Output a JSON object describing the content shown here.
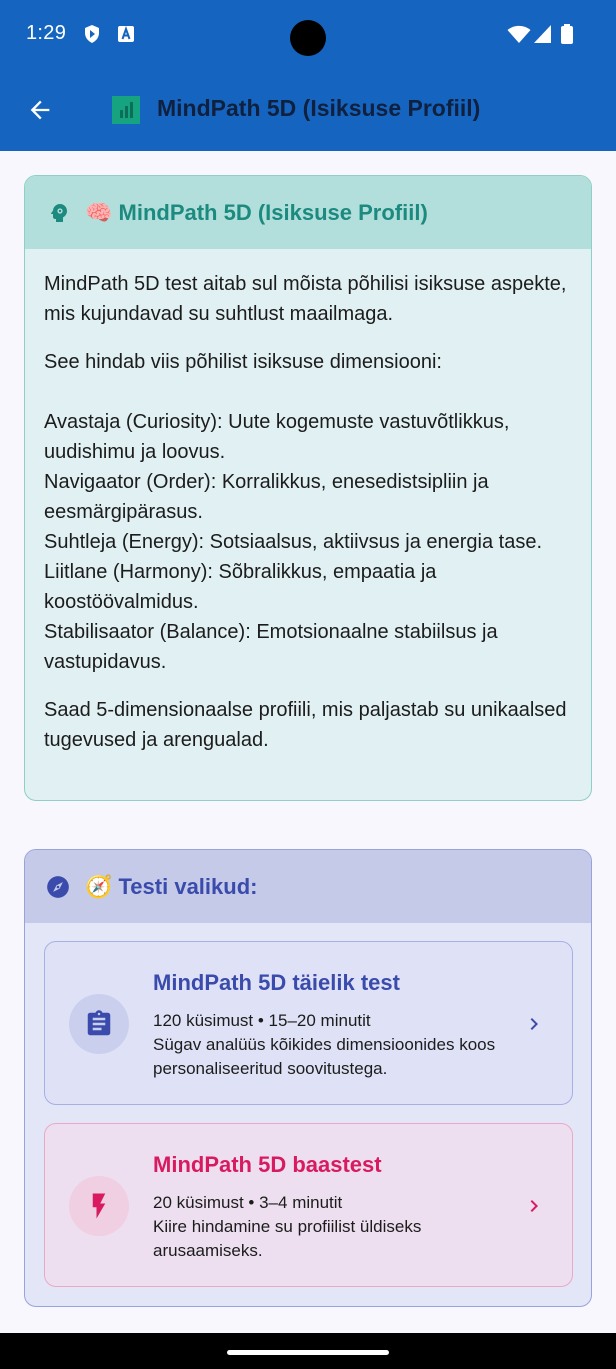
{
  "status_bar": {
    "time": "1:29"
  },
  "app_bar": {
    "title": "MindPath 5D (Isiksuse Profiil)"
  },
  "intro": {
    "title": "🧠 MindPath 5D (Isiksuse Profiil)",
    "paragraph_1": "MindPath 5D test aitab sul mõista põhilisi isiksuse aspekte, mis kujundavad su suhtlust maailmaga.",
    "paragraph_2": "See hindab viis põhilist isiksuse dimensiooni:\n\nAvastaja (Curiosity): Uute kogemuste vastuvõtlikkus, uudishimu ja loovus.\nNavigaator (Order): Korralikkus, enesedistsipliin ja eesmärgipärasus.\nSuhtleja (Energy): Sotsiaalsus, aktiivsus ja energia tase.\nLiitlane (Harmony): Sõbralikkus, empaatia ja koostöövalmidus.\nStabilisaator (Balance): Emotsionaalne stabiilsus ja vastupidavus.",
    "paragraph_3": "Saad 5-dimensionaalse profiili, mis paljastab su unikaalsed tugevused ja arengualad."
  },
  "options": {
    "title": "🧭 Testi valikud:",
    "full": {
      "title": "MindPath 5D täielik test",
      "meta": "120 küsimust • 15–20 minutit",
      "description": "Sügav analüüs kõikides dimensioonides koos personaliseeritud soovitustega."
    },
    "basic": {
      "title": "MindPath 5D baastest",
      "meta": "20 küsimust • 3–4 minutit",
      "description": "Kiire hindamine su profiilist üldiseks arusaamiseks."
    }
  },
  "colors": {
    "app_bar": "#1565c0",
    "teal_accent": "#1d8a80",
    "indigo_accent": "#3a4bab",
    "pink_accent": "#d81b60"
  }
}
